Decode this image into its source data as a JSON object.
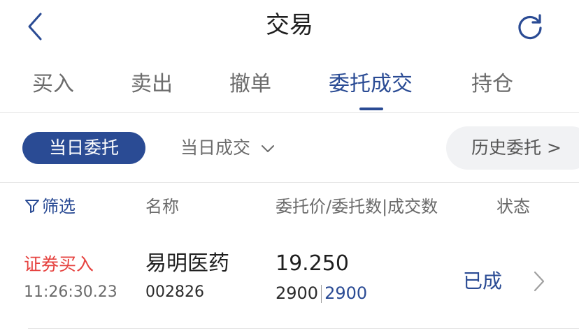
{
  "header": {
    "title": "交易",
    "back_icon": "chevron-left-icon",
    "refresh_icon": "refresh-icon"
  },
  "tabs": [
    {
      "label": "买入",
      "active": false
    },
    {
      "label": "卖出",
      "active": false
    },
    {
      "label": "撤单",
      "active": false
    },
    {
      "label": "委托成交",
      "active": true
    },
    {
      "label": "持仓",
      "active": false
    }
  ],
  "filters": {
    "today_orders": "当日委托",
    "today_deals": "当日成交",
    "history_orders": "历史委托 >"
  },
  "columns": {
    "filter": "筛选",
    "name": "名称",
    "price_qty": "委托价/委托数|成交数",
    "status": "状态"
  },
  "orders": [
    {
      "type": "证券买入",
      "time": "11:26:30.23",
      "name": "易明医药",
      "code": "002826",
      "price": "19.250",
      "order_qty": "2900",
      "filled_qty": "2900",
      "status": "已成"
    }
  ],
  "colors": {
    "accent": "#2a4b94",
    "buy_red": "#e64340"
  }
}
